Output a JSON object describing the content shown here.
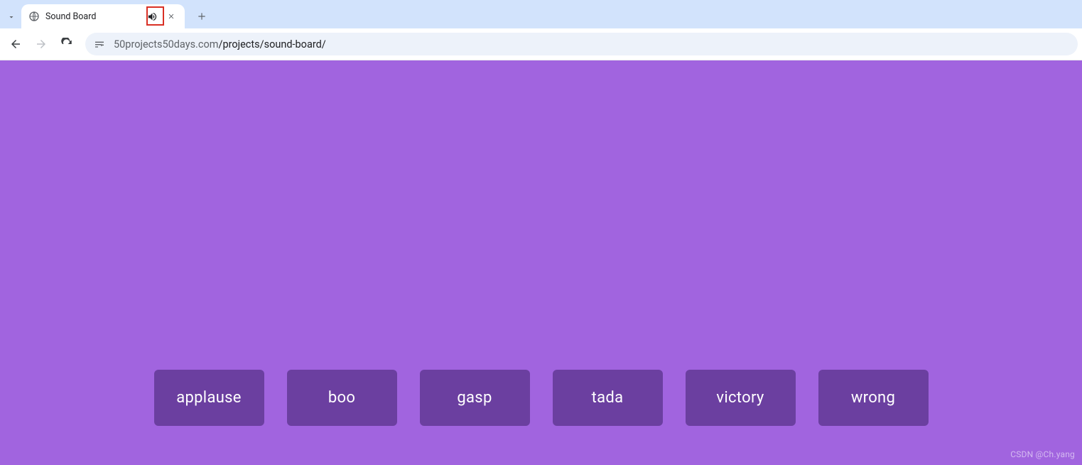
{
  "browser": {
    "tab": {
      "title": "Sound Board"
    },
    "url": {
      "host": "50projects50days.com",
      "path": "/projects/sound-board/"
    }
  },
  "sounds": [
    {
      "label": "applause"
    },
    {
      "label": "boo"
    },
    {
      "label": "gasp"
    },
    {
      "label": "tada"
    },
    {
      "label": "victory"
    },
    {
      "label": "wrong"
    }
  ],
  "watermark": "CSDN @Ch.yang"
}
